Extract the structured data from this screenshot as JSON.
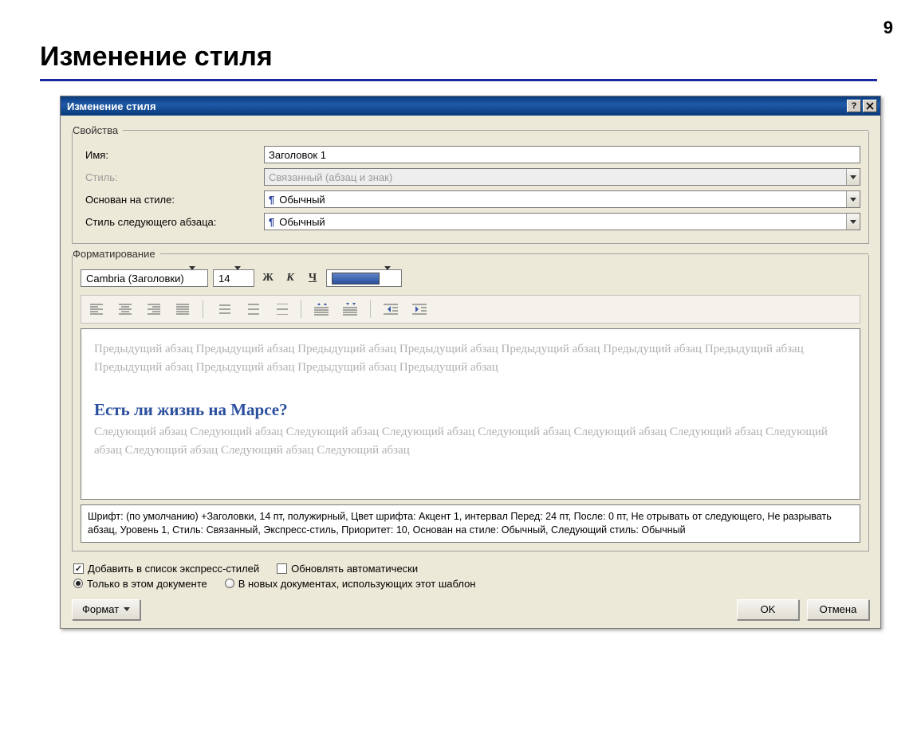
{
  "page": {
    "number": "9",
    "heading": "Изменение стиля"
  },
  "dialog": {
    "title": "Изменение стиля",
    "groups": {
      "properties": "Свойства",
      "formatting": "Форматирование"
    },
    "labels": {
      "name": "Имя:",
      "styleType": "Стиль:",
      "basedOn": "Основан на стиле:",
      "nextStyle": "Стиль следующего абзаца:"
    },
    "values": {
      "name": "Заголовок 1",
      "styleType": "Связанный (абзац и знак)",
      "basedOn": "Обычный",
      "nextStyle": "Обычный"
    },
    "format": {
      "font": "Cambria (Заголовки)",
      "size": "14",
      "bold": "Ж",
      "italic": "К",
      "underline": "Ч"
    },
    "preview": {
      "prevPara": "Предыдущий абзац Предыдущий абзац Предыдущий абзац Предыдущий абзац Предыдущий абзац Предыдущий абзац Предыдущий абзац Предыдущий абзац Предыдущий абзац Предыдущий абзац Предыдущий абзац",
      "heading": "Есть ли жизнь на Марсе?",
      "nextPara": "Следующий абзац Следующий абзац Следующий абзац Следующий абзац Следующий абзац Следующий абзац Следующий абзац Следующий абзац Следующий абзац Следующий абзац Следующий абзац"
    },
    "description": "Шрифт: (по умолчанию) +Заголовки, 14 пт, полужирный, Цвет шрифта: Акцент 1, интервал Перед:  24 пт, После:  0 пт, Не отрывать от следующего, Не разрывать абзац, Уровень 1, Стиль: Связанный, Экспресс-стиль, Приоритет: 10, Основан на стиле: Обычный, Следующий стиль: Обычный",
    "options": {
      "addToQuick": "Добавить в список экспресс-стилей",
      "autoUpdate": "Обновлять автоматически",
      "thisDoc": "Только в этом документе",
      "newDocs": "В новых документах, использующих этот шаблон"
    },
    "buttons": {
      "format": "Формат",
      "ok": "OK",
      "cancel": "Отмена"
    }
  }
}
